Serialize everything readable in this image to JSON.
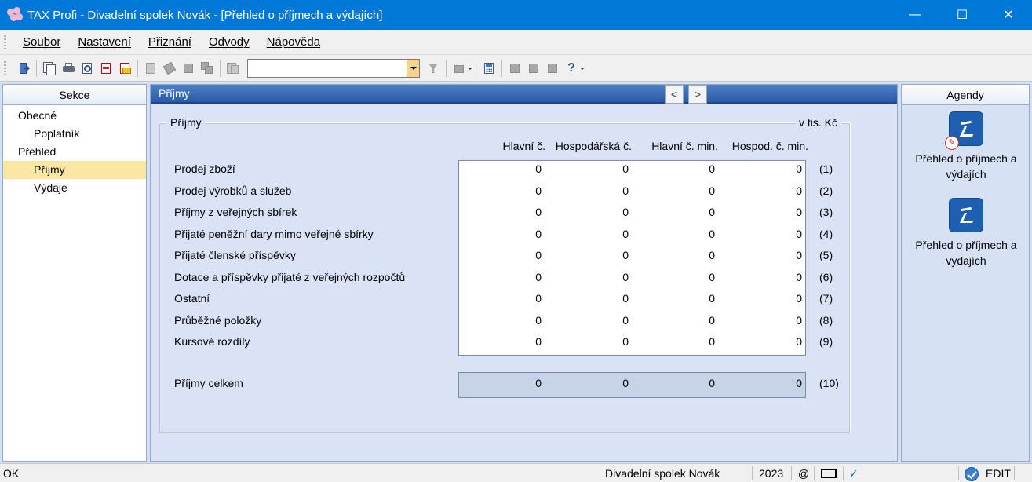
{
  "window": {
    "title": "TAX Profi - Divadelní spolek Novák - [Přehled o příjmech a výdajích]",
    "controls": {
      "minimize": "—",
      "maximize": "☐",
      "close": "✕"
    }
  },
  "menu": [
    {
      "label": "Soubor"
    },
    {
      "label": "Nastavení"
    },
    {
      "label": "Přiznání"
    },
    {
      "label": "Odvody"
    },
    {
      "label": "Nápověda"
    }
  ],
  "toolbar": {
    "combo_value": "",
    "help_label": "?"
  },
  "sections": {
    "header": "Sekce",
    "items": [
      {
        "label": "Obecné",
        "level": 1
      },
      {
        "label": "Poplatník",
        "level": 2
      },
      {
        "label": "Přehled",
        "level": 1
      },
      {
        "label": "Příjmy",
        "level": 2,
        "selected": true
      },
      {
        "label": "Výdaje",
        "level": 2
      }
    ]
  },
  "main": {
    "header": "Příjmy",
    "nav_prev": "<",
    "nav_next": ">",
    "group_title": "Příjmy",
    "unit": "v tis. Kč",
    "columns": [
      "Hlavní č.",
      "Hospodářská č.",
      "Hlavní č. min.",
      "Hospod. č. min."
    ],
    "rows": [
      {
        "label": "Prodej zboží",
        "values": [
          "0",
          "0",
          "0",
          "0"
        ],
        "num": "(1)"
      },
      {
        "label": "Prodej výrobků a služeb",
        "values": [
          "0",
          "0",
          "0",
          "0"
        ],
        "num": "(2)"
      },
      {
        "label": "Příjmy z veřejných sbírek",
        "values": [
          "0",
          "0",
          "0",
          "0"
        ],
        "num": "(3)"
      },
      {
        "label": "Přijaté peněžní dary mimo veřejné sbírky",
        "values": [
          "0",
          "0",
          "0",
          "0"
        ],
        "num": "(4)"
      },
      {
        "label": "Přijaté členské příspěvky",
        "values": [
          "0",
          "0",
          "0",
          "0"
        ],
        "num": "(5)"
      },
      {
        "label": "Dotace a příspěvky přijaté z veřejných rozpočtů",
        "values": [
          "0",
          "0",
          "0",
          "0"
        ],
        "num": "(6)"
      },
      {
        "label": "Ostatní",
        "values": [
          "0",
          "0",
          "0",
          "0"
        ],
        "num": "(7)"
      },
      {
        "label": "Průběžné položky",
        "values": [
          "0",
          "0",
          "0",
          "0"
        ],
        "num": "(8)"
      },
      {
        "label": "Kursové rozdíly",
        "values": [
          "0",
          "0",
          "0",
          "0"
        ],
        "num": "(9)"
      }
    ],
    "total": {
      "label": "Příjmy celkem",
      "values": [
        "0",
        "0",
        "0",
        "0"
      ],
      "num": "(10)"
    }
  },
  "agendas": {
    "header": "Agendy",
    "items": [
      {
        "label": "Přehled o příjmech a výdajích",
        "editing": true
      },
      {
        "label": "Přehled o příjmech a výdajích",
        "editing": false
      }
    ]
  },
  "status": {
    "left": "OK",
    "company": "Divadelní spolek Novák",
    "year": "2023",
    "at": "@",
    "mode": "EDIT"
  }
}
